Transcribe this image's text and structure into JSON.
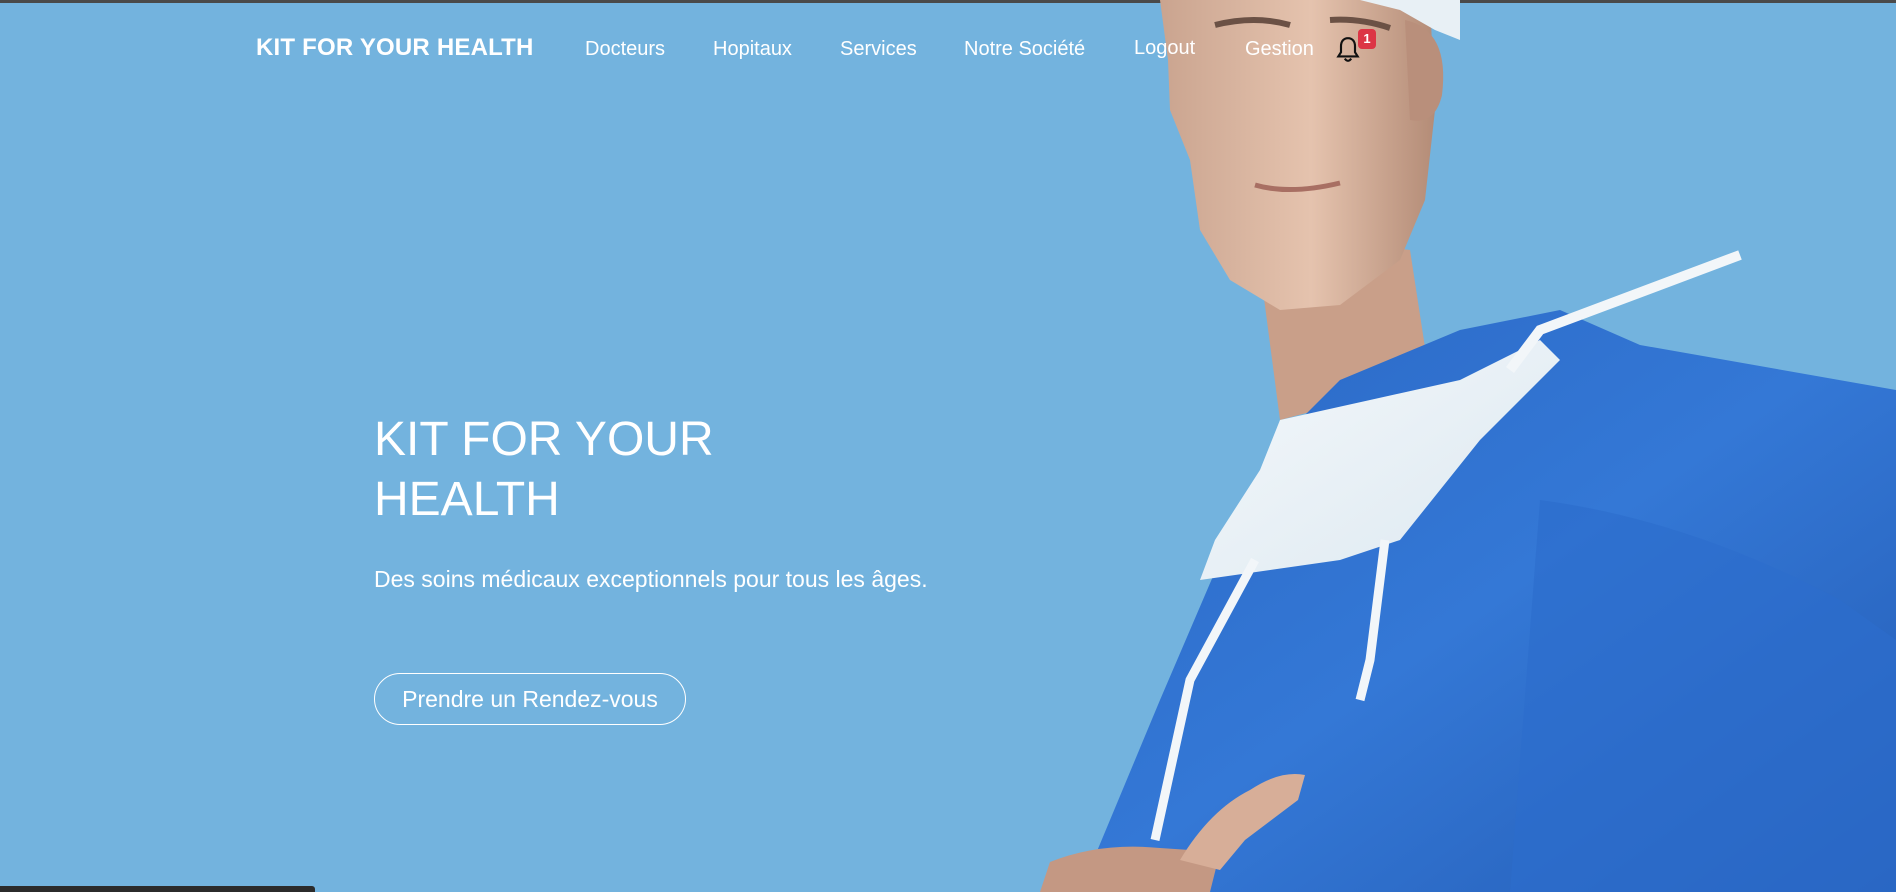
{
  "navbar": {
    "brand": "KIT FOR YOUR HEALTH",
    "items": [
      {
        "label": "Docteurs"
      },
      {
        "label": "Hopitaux"
      },
      {
        "label": "Services"
      },
      {
        "label": "Notre Société"
      },
      {
        "label": "Logout"
      },
      {
        "label": "Gestion"
      }
    ],
    "notifications": {
      "icon": "bell-icon",
      "count": "1"
    }
  },
  "hero": {
    "title": "KIT FOR YOUR HEALTH",
    "subtitle": "Des soins médicaux exceptionnels pour tous les âges.",
    "cta_label": "Prendre un Rendez-vous"
  },
  "colors": {
    "background": "#73b3de",
    "text": "#ffffff",
    "badge": "#dc3545",
    "scrubs": "#2f72d2"
  }
}
